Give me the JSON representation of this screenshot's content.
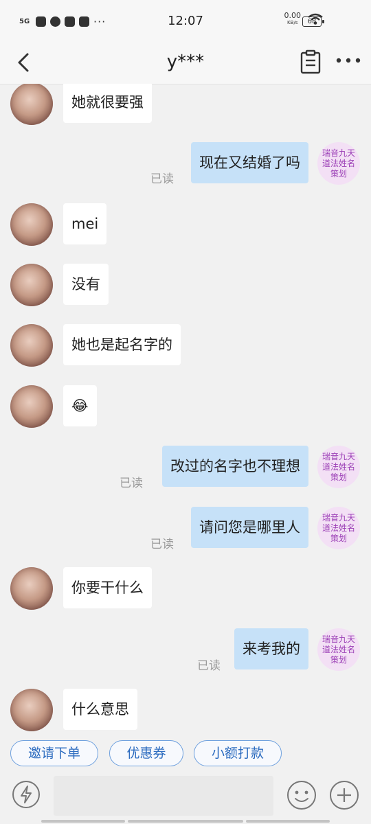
{
  "status_bar": {
    "network": "5G",
    "time": "12:07",
    "net_speed": "0.00",
    "net_speed_unit": "KB/s",
    "battery": "68"
  },
  "header": {
    "title": "y***"
  },
  "shop_avatar_text": "瑞音九天道法姓名策划",
  "read_label": "已读",
  "messages": [
    {
      "side": "left",
      "text": "她就很要强"
    },
    {
      "side": "right",
      "text": "现在又结婚了吗",
      "read": "已读"
    },
    {
      "side": "left",
      "text": "mei"
    },
    {
      "side": "left",
      "text": "没有"
    },
    {
      "side": "left",
      "text": "她也是起名字的"
    },
    {
      "side": "left",
      "text": "😂"
    },
    {
      "side": "right",
      "text": "改过的名字也不理想",
      "read": "已读"
    },
    {
      "side": "right",
      "text": "请问您是哪里人",
      "read": "已读"
    },
    {
      "side": "left",
      "text": "你要干什么"
    },
    {
      "side": "right",
      "text": "来考我的",
      "read": "已读"
    },
    {
      "side": "left",
      "text": "什么意思"
    }
  ],
  "quick_actions": [
    "邀请下单",
    "优惠券",
    "小额打款"
  ],
  "input": {
    "placeholder": ""
  },
  "colors": {
    "outgoing_bubble": "#c6e1f8",
    "incoming_bubble": "#ffffff",
    "accent": "#2e6dc0",
    "shop_avatar_text": "#9b3fb6"
  }
}
